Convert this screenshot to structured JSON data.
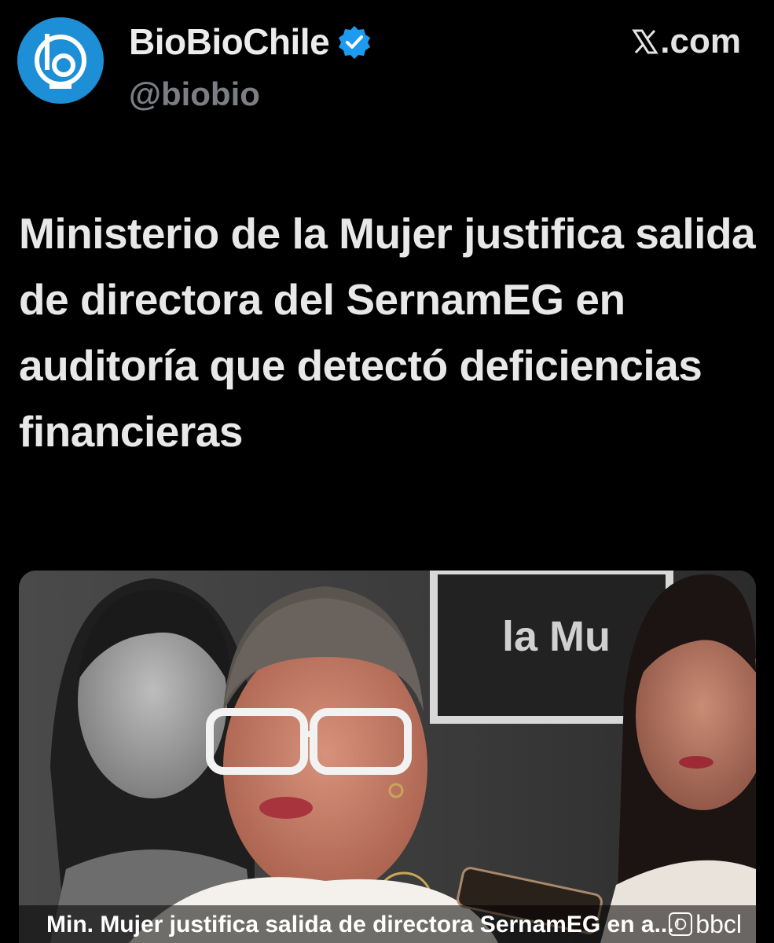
{
  "account": {
    "display_name": "BioBioChile",
    "handle": "@biobio",
    "avatar_icon": "biobio-logo-icon",
    "verified_icon": "verified-badge-icon",
    "brand_color": "#1d8fd6",
    "verified_color": "#1d9bf0"
  },
  "source": {
    "label": ".com",
    "logo_icon": "x-logo-icon"
  },
  "post": {
    "headline": "Ministerio de la Mujer justifica salida de directora del SernamEG en auditoría que detectó deficiencias financieras"
  },
  "card": {
    "caption": "Min. Mujer justifica salida de directora SernamEG en a...",
    "background_sign_text": "la Mu",
    "watermark_text": "bbcl"
  }
}
